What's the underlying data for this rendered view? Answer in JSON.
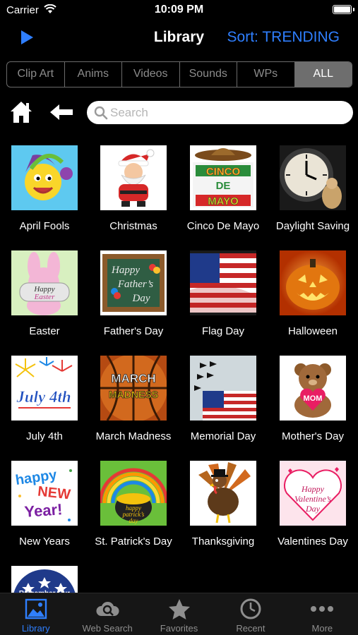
{
  "status_bar": {
    "carrier": "Carrier",
    "time": "10:09 PM"
  },
  "nav": {
    "title": "Library",
    "sort_label": "Sort: TRENDING"
  },
  "segments": [
    {
      "label": "Clip Art",
      "active": false
    },
    {
      "label": "Anims",
      "active": false
    },
    {
      "label": "Videos",
      "active": false
    },
    {
      "label": "Sounds",
      "active": false
    },
    {
      "label": "WPs",
      "active": false
    },
    {
      "label": "ALL",
      "active": true
    }
  ],
  "search": {
    "placeholder": "Search",
    "value": ""
  },
  "library_items": [
    {
      "label": "April Fools",
      "thumb_text": ""
    },
    {
      "label": "Christmas",
      "thumb_text": ""
    },
    {
      "label": "Cinco De Mayo",
      "thumb_text": "CINCO DE MAYO"
    },
    {
      "label": "Daylight Saving",
      "thumb_text": ""
    },
    {
      "label": "Easter",
      "thumb_text": "Happy Easter"
    },
    {
      "label": "Father's Day",
      "thumb_text": "Happy Father's Day"
    },
    {
      "label": "Flag Day",
      "thumb_text": ""
    },
    {
      "label": "Halloween",
      "thumb_text": ""
    },
    {
      "label": "July 4th",
      "thumb_text": "July 4th"
    },
    {
      "label": "March Madness",
      "thumb_text": "MARCH MADNESS"
    },
    {
      "label": "Memorial Day",
      "thumb_text": ""
    },
    {
      "label": "Mother's Day",
      "thumb_text": "MOM"
    },
    {
      "label": "New Years",
      "thumb_text": "happy NEW Year!"
    },
    {
      "label": "St. Patrick's Day",
      "thumb_text": "happy patrick's day"
    },
    {
      "label": "Thanksgiving",
      "thumb_text": ""
    },
    {
      "label": "Valentines Day",
      "thumb_text": "Happy Valentine's Day"
    },
    {
      "label": "",
      "thumb_text": "Remember Our"
    }
  ],
  "tabs": [
    {
      "label": "Library",
      "icon": "photo-icon",
      "active": true
    },
    {
      "label": "Web Search",
      "icon": "cloud-search-icon",
      "active": false
    },
    {
      "label": "Favorites",
      "icon": "star-icon",
      "active": false
    },
    {
      "label": "Recent",
      "icon": "clock-icon",
      "active": false
    },
    {
      "label": "More",
      "icon": "more-dots-icon",
      "active": false
    }
  ],
  "colors": {
    "accent": "#2f7fff",
    "background": "#000000",
    "segment_active": "#6e6e6e"
  }
}
